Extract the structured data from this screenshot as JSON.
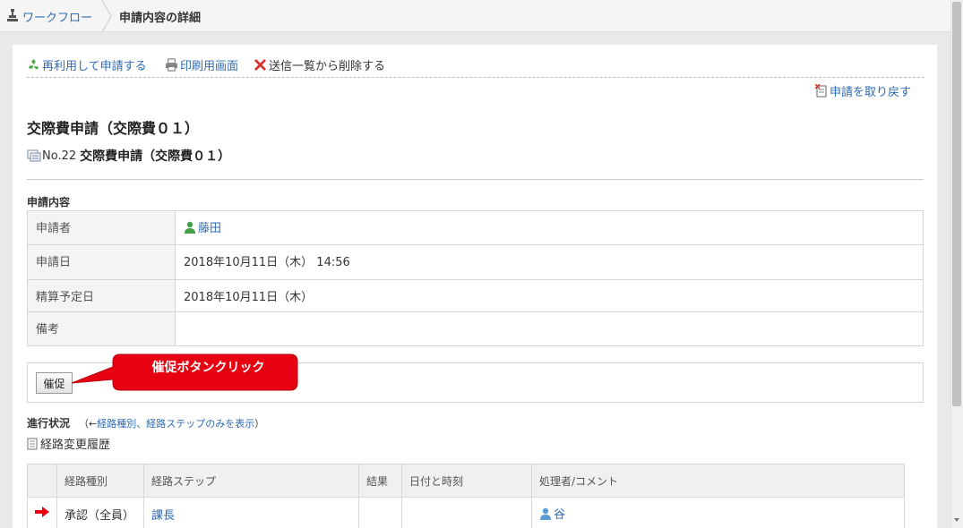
{
  "breadcrumb": {
    "workflow_label": "ワークフロー",
    "current_label": "申請内容の詳細"
  },
  "toolbar": {
    "reuse_label": "再利用して申請する",
    "print_label": "印刷用画面",
    "delete_label": "送信一覧から削除する",
    "withdraw_label": "申請を取り戻す"
  },
  "request": {
    "title": "交際費申請（交際費０１）",
    "number": "No.22",
    "name": "交際費申請（交際費０１）"
  },
  "details": {
    "section_label": "申請内容",
    "rows": [
      {
        "label": "申請者",
        "value": "藤田"
      },
      {
        "label": "申請日",
        "value": "2018年10月11日（木） 14:56"
      },
      {
        "label": "精算予定日",
        "value": "2018年10月11日（木）"
      },
      {
        "label": "備考",
        "value": ""
      }
    ]
  },
  "remind": {
    "button_label": "催促",
    "callout_text": "催促ボタンクリック",
    "callout_color": "#e60012"
  },
  "progress": {
    "title": "進行状況",
    "note_prefix": "（←",
    "note_link": "経路種別、経路ステップのみを表示",
    "note_suffix": "）",
    "history_label": "経路変更履歴",
    "columns": [
      "",
      "経路種別",
      "経路ステップ",
      "結果",
      "日付と時刻",
      "処理者/コメント"
    ],
    "rows": [
      {
        "type": "承認（全員）",
        "step": "課長",
        "result": "",
        "datetime": "",
        "handler": "谷"
      }
    ]
  },
  "colors": {
    "link": "#2e6cb5",
    "arrow": "#e60012"
  }
}
